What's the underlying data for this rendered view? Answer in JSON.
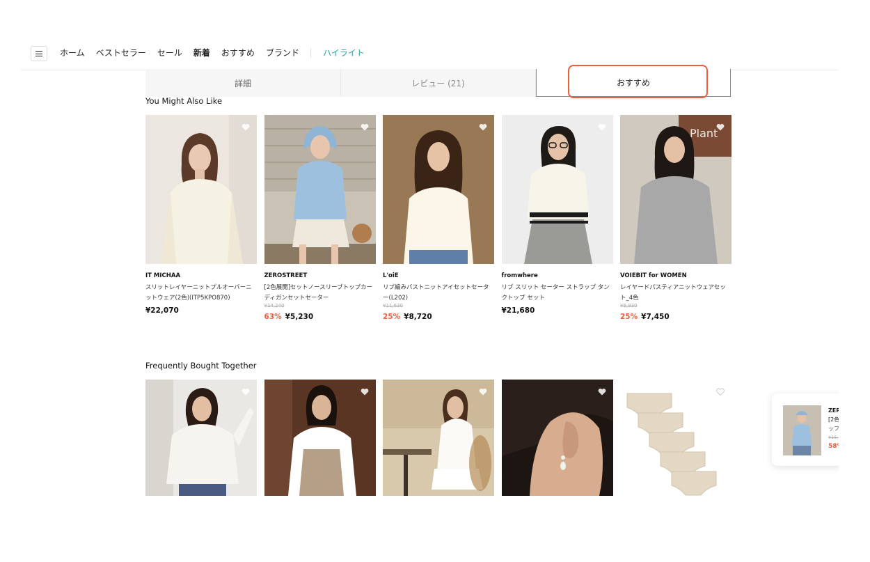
{
  "nav": {
    "items": [
      "ホーム",
      "ベストセラー",
      "セール",
      "新着",
      "おすすめ",
      "ブランド"
    ],
    "highlight": "ハイライト"
  },
  "tabs": [
    "詳細",
    "レビュー (21)",
    "おすすめ"
  ],
  "sections": {
    "you_might_also_like": "You Might Also Like",
    "frequently_bought_together": "Frequently Bought Together"
  },
  "products": [
    {
      "brand": "IT MICHAA",
      "name": "スリットレイヤーニットプルオーバーニットウェア(2色)(ITP5KPO870)",
      "price": "¥22,070"
    },
    {
      "brand": "ZEROSTREET",
      "name": "[2色展開]セットノースリーブトップカーディガンセットセーター",
      "original_price": "¥14,240",
      "discount": "63%",
      "price": "¥5,230"
    },
    {
      "brand": "L'oiE",
      "name": "リブ編みバストニットアイセットセーター(L202)",
      "original_price": "¥11,630",
      "discount": "25%",
      "price": "¥8,720"
    },
    {
      "brand": "fromwhere",
      "name": "リブ スリット セーター ストラップ タンクトップ セット",
      "price": "¥21,680"
    },
    {
      "brand": "VOIEBIT for WOMEN",
      "name": "レイヤードパスティアニットウェアセット_4色",
      "original_price": "¥9,930",
      "discount": "25%",
      "price": "¥7,450"
    }
  ],
  "recent": {
    "brand": "ZER",
    "line1": "[2色",
    "line2": "ッフ",
    "orig": "¥15,",
    "disc": "58%"
  },
  "colors": {
    "accent": "#f05d3c",
    "highlight": "#2aa7a0"
  }
}
